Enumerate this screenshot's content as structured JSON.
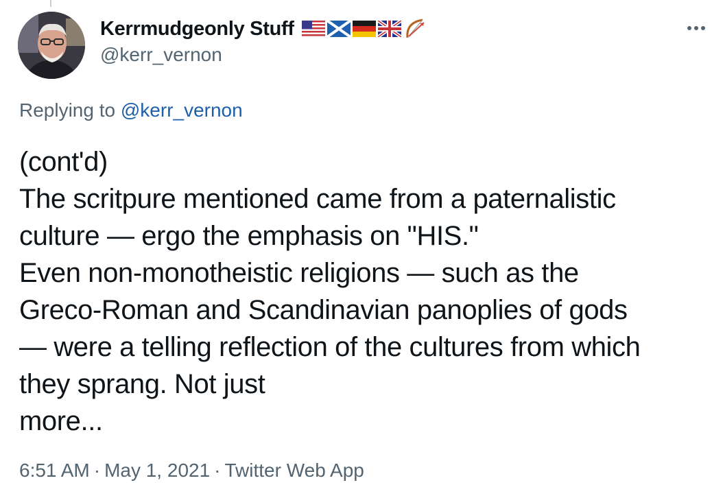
{
  "author": {
    "display_name": "Kerrmudgeonly Stuff",
    "handle": "@kerr_vernon",
    "flag_icons": [
      "us-flag-icon",
      "scotland-flag-icon",
      "germany-flag-icon",
      "uk-flag-icon",
      "bow-and-arrow-icon"
    ]
  },
  "reply": {
    "prefix": "Replying to ",
    "mention": "@kerr_vernon"
  },
  "tweet": {
    "lines": [
      "(cont'd)",
      "The scritpure mentioned came from a paternalistic",
      "culture — ergo the emphasis on \"HIS.\"",
      "Even non-monotheistic religions — such as the",
      "Greco-Roman and Scandinavian panoplies of gods",
      "— were a telling reflection of the cultures from which",
      "they sprang.  Not just",
      "more..."
    ]
  },
  "meta": {
    "time": "6:51 AM",
    "separator": "·",
    "date": "May 1, 2021",
    "source": "Twitter Web App"
  },
  "colors": {
    "text": "#0f1419",
    "secondary": "#536471",
    "link": "#1d5fa8"
  }
}
